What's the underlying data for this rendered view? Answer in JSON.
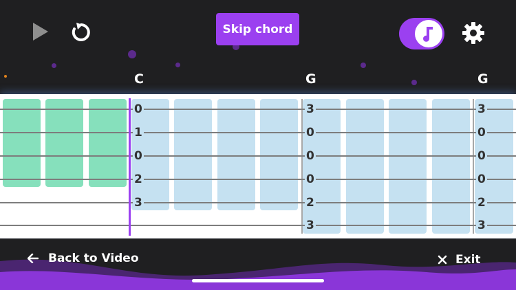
{
  "controls": {
    "play_icon": "play-icon",
    "restart_icon": "restart-icon",
    "skip_label": "Skip chord",
    "toggle_icon": "music-note-icon",
    "settings_icon": "gear-icon"
  },
  "chords": [
    {
      "name": "C"
    },
    {
      "name": "G"
    },
    {
      "name": "G"
    }
  ],
  "frets": {
    "C": [
      "0",
      "1",
      "0",
      "2",
      "3"
    ],
    "G1": [
      "3",
      "0",
      "0",
      "0",
      "2",
      "3"
    ],
    "G2": [
      "3",
      "0",
      "0",
      "0",
      "2",
      "3"
    ]
  },
  "footer": {
    "back_label": "Back to Video",
    "exit_label": "Exit"
  },
  "colors": {
    "accent": "#9b40f0",
    "played_tile": "#86e0bc",
    "upcoming_tile": "#c5e1f1",
    "background": "#1f1f21"
  }
}
